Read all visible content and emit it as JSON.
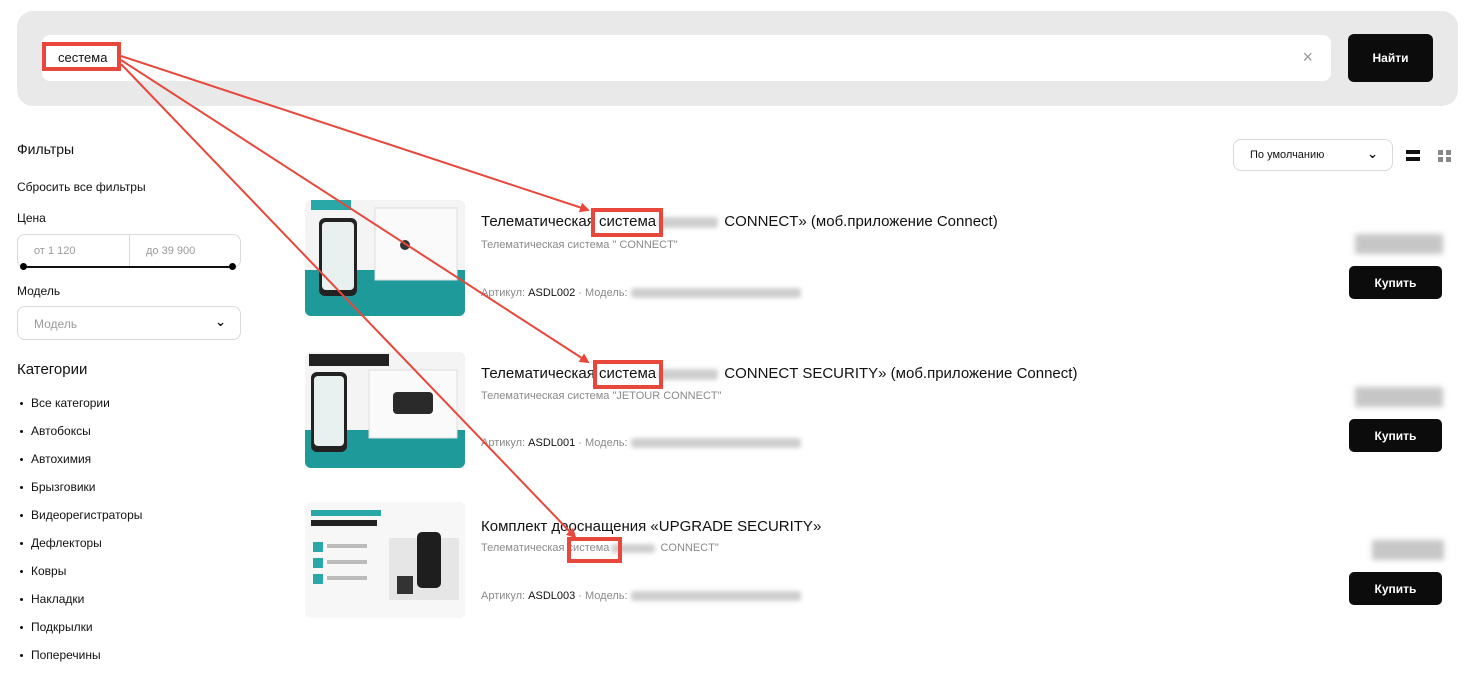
{
  "search": {
    "query": "сестема",
    "clear_icon": "×",
    "button_label": "Найти"
  },
  "sidebar": {
    "filters_title": "Фильтры",
    "reset_label": "Сбросить все фильтры",
    "price_label": "Цена",
    "price_from": "от 1 120",
    "price_to": "до 39 900",
    "model_label": "Модель",
    "model_placeholder": "Модель",
    "categories_title": "Категории",
    "categories": [
      "Все категории",
      "Автобоксы",
      "Автохимия",
      "Брызговики",
      "Видеорегистраторы",
      "Дефлекторы",
      "Ковры",
      "Накладки",
      "Подкрылки",
      "Поперечины"
    ]
  },
  "sort": {
    "selected": "По умолчанию"
  },
  "products": [
    {
      "title_pre": "Телематическая ",
      "title_hl": "система",
      "title_post": " CONNECT» (моб.приложение Connect)",
      "subtitle": "Телематическая система \" CONNECT\"",
      "article_label": "Артикул:",
      "article": "ASDL002",
      "model_label": "· Модель:",
      "buy_label": "Купить"
    },
    {
      "title_pre": "Телематическая ",
      "title_hl": "система",
      "title_post": " CONNECT SECURITY» (моб.приложение Connect)",
      "subtitle": "Телематическая система \"JETOUR CONNECT\"",
      "article_label": "Артикул:",
      "article": "ASDL001",
      "model_label": "· Модель:",
      "buy_label": "Купить"
    },
    {
      "title_pre": "Комплект дооснащения «UPGRADE SECURITY»",
      "title_hl": "",
      "title_post": "",
      "subtitle_pre": "Телематическая ",
      "subtitle_hl": "система",
      "subtitle_post": " CONNECT\"",
      "article_label": "Артикул:",
      "article": "ASDL003",
      "model_label": "· Модель:",
      "buy_label": "Купить"
    }
  ],
  "colors": {
    "highlight": "#e8483b",
    "button": "#0c0c0c"
  }
}
